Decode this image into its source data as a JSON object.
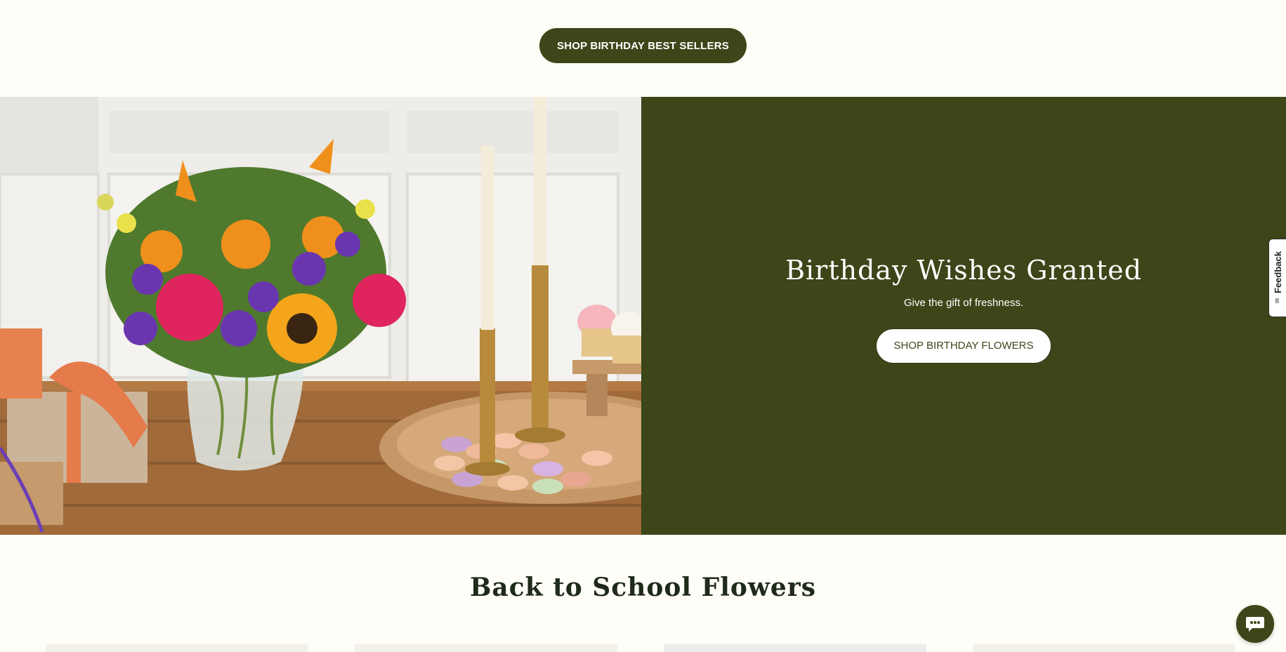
{
  "top_cta": {
    "label": "SHOP BIRTHDAY BEST SELLERS"
  },
  "hero": {
    "title": "Birthday Wishes Granted",
    "subtitle": "Give the gift of freshness.",
    "cta_label": "SHOP BIRTHDAY FLOWERS",
    "image_icon": "birthday-bouquet-photo"
  },
  "section": {
    "title": "Back to School Flowers"
  },
  "feedback": {
    "label": "Feedback",
    "icon": "feedback-icon"
  },
  "chat": {
    "icon": "chat-bubble-icon"
  },
  "colors": {
    "page_background": "#fefdf7",
    "brand_green": "#3c4619",
    "white": "#ffffff",
    "heading_text": "#1f2a1a"
  }
}
